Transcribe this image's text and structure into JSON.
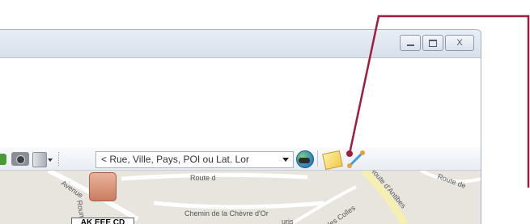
{
  "toolbar": {
    "search_placeholder": "< Rue, Ville, Pays, POI ou Lat. Lor"
  },
  "window_buttons": {
    "close_glyph": "X"
  },
  "map": {
    "labels": [
      "Route d",
      "Avenue",
      "Roume",
      "Chemin de la Chèvre d'Or",
      "Route d'Antibes",
      "des Colles",
      "Route de",
      "uris"
    ],
    "poi_label": "AK EEE CD"
  },
  "colors": {
    "callout_line": "#a01c3c",
    "road": "#ffffff",
    "map_background": "#e8e5de"
  },
  "icons": [
    "camera-icon",
    "cube-icon",
    "globe-icon",
    "note-icon",
    "route-icon"
  ]
}
